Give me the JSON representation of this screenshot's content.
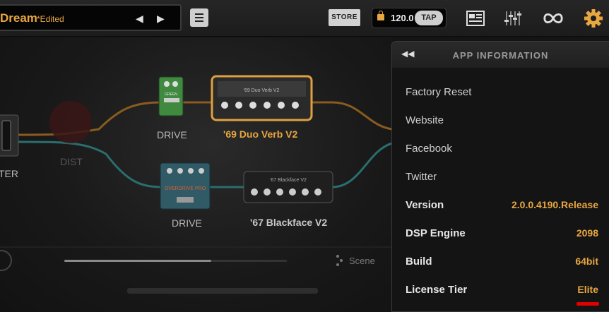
{
  "header": {
    "preset_name": "Dream",
    "preset_edited": "*Edited",
    "prev_icon": "triangle-left-icon",
    "next_icon": "triangle-right-icon",
    "menu_icon": "hamburger-icon",
    "store_label": "STORE",
    "tempo": "120.0",
    "tap_label": "TAP",
    "icons": [
      "lock-icon",
      "presets-book-icon",
      "mixer-icon",
      "loop-icon",
      "gear-icon"
    ],
    "accent_color": "#e8a640"
  },
  "signal_chain": {
    "input_label": "TER",
    "dist_label": "DIST",
    "top_pedal_label": "DRIVE",
    "top_pedal_text": "GREEN",
    "top_amp_label": "'69 Duo Verb V2",
    "top_amp_plate": "'69 Duo Verb V2",
    "bottom_pedal_label": "DRIVE",
    "bottom_pedal_text": "OVERDRIVE PRO",
    "bottom_amp_label": "'67 Blackface V2",
    "bottom_amp_plate": "'67 Blackface V2",
    "scene_label": "Scene",
    "scroll_position": 0.66
  },
  "app_info": {
    "back_icon": "double-chevron-left-icon",
    "title": "APP INFORMATION",
    "links": [
      {
        "label": "Factory Reset"
      },
      {
        "label": "Website"
      },
      {
        "label": "Facebook"
      },
      {
        "label": "Twitter"
      }
    ],
    "details": [
      {
        "label": "Version",
        "value": "2.0.0.4190.Release"
      },
      {
        "label": "DSP Engine",
        "value": "2098"
      },
      {
        "label": "Build",
        "value": "64bit"
      },
      {
        "label": "License Tier",
        "value": "Elite"
      }
    ]
  }
}
